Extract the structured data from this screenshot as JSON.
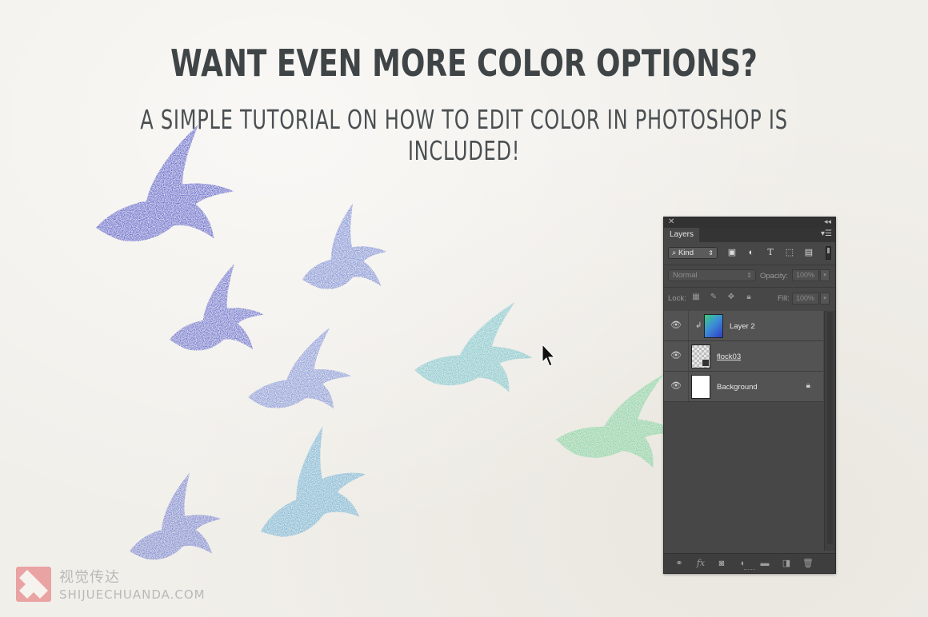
{
  "headline": "WANT EVEN MORE COLOR OPTIONS?",
  "subheadline": "A SIMPLE TUTORIAL ON HOW TO EDIT COLOR IN PHOTOSHOP IS INCLUDED!",
  "colors": {
    "background": "#f1efea",
    "text": "#3f4446",
    "bird_blue_deep": "#2e36c4",
    "bird_blue_mid": "#4a64cf",
    "bird_sky": "#4aa6d2",
    "bird_teal": "#4fbac6",
    "bird_green": "#5ed08a",
    "panel_bg": "#474747"
  },
  "cursor_icon": "arrow-pointer-icon",
  "layers_panel": {
    "tab_label": "Layers",
    "filter_kind_label": "Kind",
    "filter_icons": [
      "image-filter-icon",
      "adjustment-filter-icon",
      "type-filter-icon",
      "shape-filter-icon",
      "smart-object-filter-icon"
    ],
    "blend_mode": "Normal",
    "opacity_label": "Opacity:",
    "opacity_value": "100%",
    "lock_label": "Lock:",
    "fill_label": "Fill:",
    "fill_value": "100%",
    "layers": [
      {
        "name": "Layer 2",
        "visible": true,
        "clipped": true
      },
      {
        "name": "flock03",
        "visible": true,
        "smart_object": true
      },
      {
        "name": "Background",
        "visible": true,
        "locked": true
      }
    ],
    "bottom_icons": [
      "link-icon",
      "fx-icon",
      "mask-icon",
      "adjustment-icon",
      "folder-icon",
      "new-layer-icon",
      "trash-icon"
    ]
  },
  "watermark": {
    "chinese": "视觉传达",
    "site": "SHIJUECHUANDA.COM"
  }
}
